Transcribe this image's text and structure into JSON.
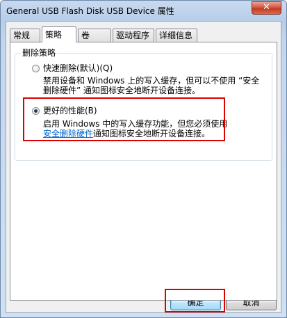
{
  "window": {
    "title": "General USB Flash Disk USB Device 属性",
    "close_glyph": "✕"
  },
  "tabs": [
    {
      "label": "常规"
    },
    {
      "label": "策略"
    },
    {
      "label": "卷"
    },
    {
      "label": "驱动程序"
    },
    {
      "label": "详细信息"
    }
  ],
  "active_tab": "策略",
  "removal_policy": {
    "group_title": "删除策略",
    "quick_removal": {
      "label": "快速删除(默认)(Q)",
      "line1": "禁用设备和 Windows 上的写入缓存，但可以不使用 “安全",
      "line2": "删除硬件” 通知图标安全地断开设备连接。",
      "checked": false
    },
    "better_performance": {
      "label": "更好的性能(B)",
      "line1": "启用 Windows 中的写入缓存功能，但您必须使用",
      "line2_link": "安全删除硬件",
      "line2_rest": "通知图标安全地断开设备连接。",
      "checked": true
    }
  },
  "buttons": {
    "ok": "确定",
    "cancel": "取消"
  },
  "colors": {
    "highlight_box": "#dd0000",
    "link": "#0066cc",
    "close_button": "#c8432a"
  }
}
